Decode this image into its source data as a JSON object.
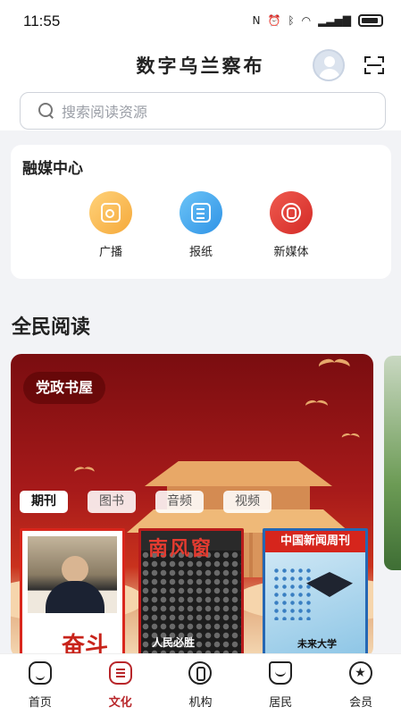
{
  "status_bar": {
    "time": "11:55",
    "indicators": [
      "nfc-icon",
      "alarm-icon",
      "bluetooth-icon",
      "wifi-icon",
      "signal-icon",
      "battery-icon"
    ]
  },
  "header": {
    "app_title": "数字乌兰察布",
    "search_placeholder": "搜索阅读资源"
  },
  "media_center": {
    "title": "融媒中心",
    "items": [
      {
        "label": "广播",
        "icon": "radio-icon",
        "color": "#f5a93a"
      },
      {
        "label": "报纸",
        "icon": "newspaper-icon",
        "color": "#2f93e6"
      },
      {
        "label": "新媒体",
        "icon": "new-media-icon",
        "color": "#d42b27"
      }
    ]
  },
  "reading": {
    "title": "全民阅读",
    "banner_tag": "党政书屋",
    "tabs": [
      "期刊",
      "图书",
      "音频",
      "视频"
    ],
    "active_tab": "期刊",
    "covers": [
      {
        "masthead": "",
        "headline": "",
        "seal": "奋斗"
      },
      {
        "masthead": "南风窗",
        "headline": "人民必胜"
      },
      {
        "masthead": "中国新闻周刊",
        "headline": "未来大学"
      }
    ]
  },
  "bottom_nav": {
    "items": [
      {
        "label": "首页",
        "icon": "home-icon"
      },
      {
        "label": "文化",
        "icon": "culture-icon"
      },
      {
        "label": "机构",
        "icon": "institution-icon"
      },
      {
        "label": "居民",
        "icon": "resident-icon"
      },
      {
        "label": "会员",
        "icon": "member-icon"
      }
    ],
    "active": "文化",
    "active_color": "#b8262a"
  }
}
